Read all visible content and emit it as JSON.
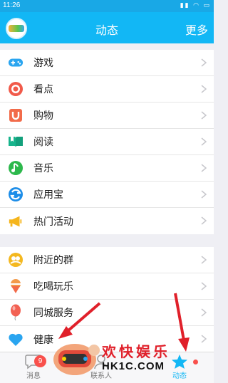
{
  "status_bar": {
    "time": "11:26"
  },
  "header": {
    "title": "动态",
    "more": "更多"
  },
  "top_list": [
    {
      "label": "游戏",
      "icon": "gamepad-icon",
      "color": "#2aa5f0"
    },
    {
      "label": "看点",
      "icon": "eye-icon",
      "color": "#f15a4a"
    },
    {
      "label": "购物",
      "icon": "shopping-bag-icon",
      "color": "#f26b4a"
    },
    {
      "label": "阅读",
      "icon": "book-icon",
      "color": "#17b48c"
    },
    {
      "label": "音乐",
      "icon": "music-icon",
      "color": "#2db84c"
    },
    {
      "label": "应用宝",
      "icon": "app-store-icon",
      "color": "#1c8de8"
    },
    {
      "label": "热门活动",
      "icon": "megaphone-icon",
      "color": "#f5b51c"
    }
  ],
  "bottom_list": [
    {
      "label": "附近的群",
      "icon": "nearby-group-icon",
      "color": "#f4b81f"
    },
    {
      "label": "吃喝玩乐",
      "icon": "ice-cream-icon",
      "color": "#f39a4a"
    },
    {
      "label": "同城服务",
      "icon": "balloon-icon",
      "color": "#f26153"
    },
    {
      "label": "健康",
      "icon": "heart-icon",
      "color": "#2aa5f0"
    }
  ],
  "tabbar": {
    "messages": {
      "label": "消息",
      "badge": "9"
    },
    "contacts": {
      "label": "联系人"
    },
    "feed": {
      "label": "动态"
    }
  },
  "watermark": {
    "cn": "欢快娱乐",
    "url": "HK1C.COM"
  },
  "colors": {
    "header": "#12b7f5",
    "arrow": "#e0202a"
  }
}
